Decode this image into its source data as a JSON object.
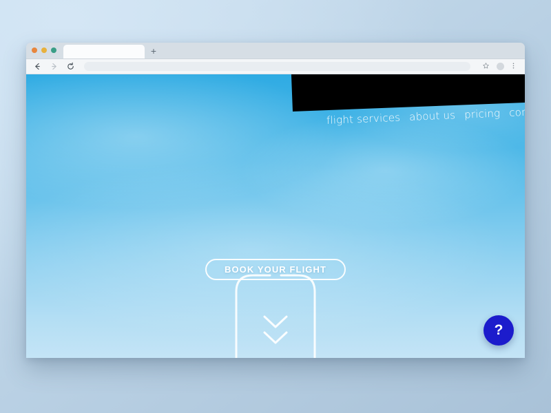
{
  "browser": {
    "traffic_lights": [
      {
        "name": "close",
        "color": "#e8863c"
      },
      {
        "name": "minimize",
        "color": "#e8b13c"
      },
      {
        "name": "maximize",
        "color": "#3a9e86"
      }
    ],
    "tab": {
      "title": ""
    },
    "new_tab_label": "+",
    "toolbar": {
      "back_icon": "back-arrow-icon",
      "forward_icon": "forward-arrow-icon",
      "reload_icon": "reload-icon",
      "url_value": "",
      "url_placeholder": "",
      "bookmark_icon": "star-icon",
      "profile_icon": "avatar-icon",
      "menu_icon": "kebab-menu-icon"
    }
  },
  "page": {
    "nav": {
      "links": [
        {
          "label": "flight services"
        },
        {
          "label": "about us"
        },
        {
          "label": "pricing"
        },
        {
          "label": "contact us"
        }
      ],
      "background_color": "#000000",
      "text_color": "#ffffff"
    },
    "hero": {
      "cta_label": "BOOK YOUR FLIGHT",
      "scroll_hint_icon": "double-chevron-down-icon",
      "sky_top_color": "#2fabe3",
      "sky_bottom_color": "#c4e4f6"
    },
    "help_button": {
      "label": "?",
      "color": "#1c1ccc"
    }
  }
}
